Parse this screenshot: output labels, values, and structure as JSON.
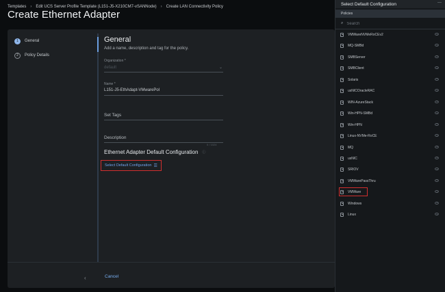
{
  "breadcrumb": [
    "Templates",
    "Edit UCS Server Profile Template (L151-J5-X210CM7-vSANNode)",
    "Create LAN Connectivity Policy"
  ],
  "breadcrumb_separator": "›",
  "page_title": "Create Ethernet Adapter",
  "steps": [
    {
      "number": "1",
      "label": "General",
      "active": true
    },
    {
      "number": "2",
      "label": "Policy Details",
      "active": false
    }
  ],
  "general": {
    "heading": "General",
    "description": "Add a name, description and tag for the policy.",
    "organization_label": "Organization *",
    "organization_value": "default",
    "name_label": "Name *",
    "name_value": "L151-J5-EthAdapt-VMwarePol",
    "tags_placeholder": "Set Tags",
    "description_placeholder": "Description",
    "description_counter": "0 / 1024"
  },
  "adapter_section": {
    "title": "Ethernet Adapter Default Configuration",
    "select_label": "Select Default Configuration"
  },
  "footer": {
    "cancel_label": "Cancel",
    "collapse_icon": "chevron-left-icon"
  },
  "panel": {
    "title": "Select Default Configuration",
    "section_label": "Policies",
    "search_placeholder": "Search",
    "policies": [
      "VMWareNVMeRoCEv2",
      "MQ-SMBd",
      "SMBServer",
      "SMBClient",
      "Solaris",
      "usNICOracleRAC",
      "WIN-AzureStack",
      "Win-HPN-SMBd",
      "Win-HPN",
      "Linux-NVMe-RoCE",
      "MQ",
      "usNIC",
      "SRIOV",
      "VMWarePassThru",
      "VMWare",
      "Windows",
      "Linux"
    ],
    "highlighted_policy": "VMWare"
  },
  "colors": {
    "accent": "#6fa3ee",
    "highlight_border": "#d22f2f",
    "background": "#0b0d0f",
    "card": "#1d2023"
  }
}
